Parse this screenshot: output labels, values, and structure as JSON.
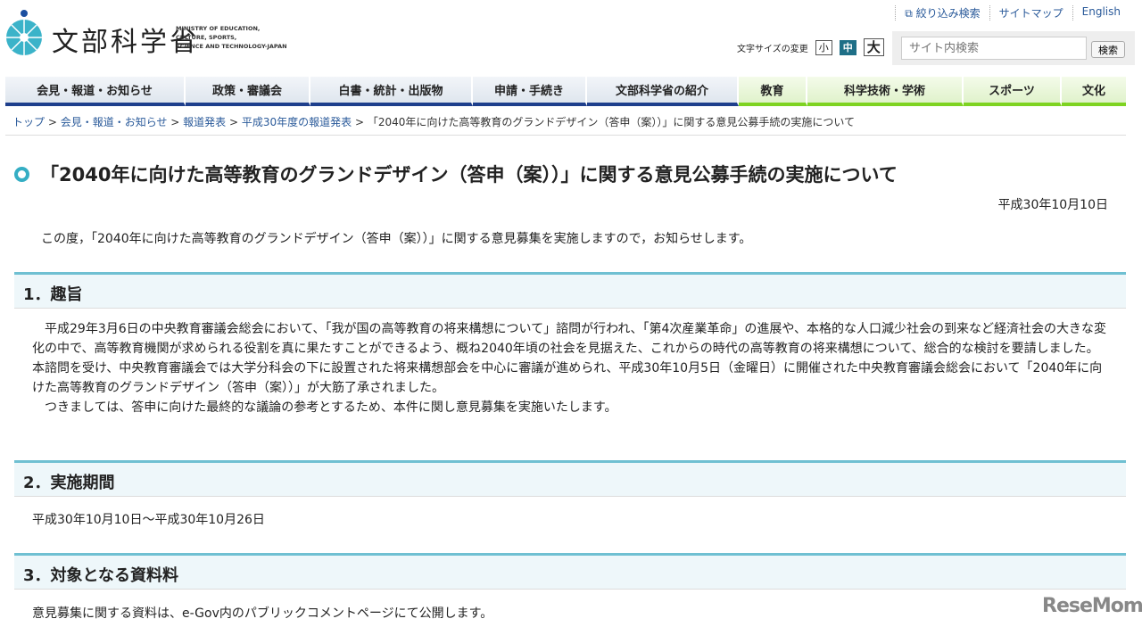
{
  "header": {
    "logo_jp": "文部科学省",
    "logo_en": [
      "MINISTRY OF EDUCATION,",
      "CULTURE, SPORTS,",
      "SCIENCE AND TECHNOLOGY-JAPAN"
    ],
    "links": [
      "絞り込み検索",
      "サイトマップ",
      "English"
    ],
    "font_size_label": "文字サイズの変更",
    "font_sizes": [
      "小",
      "中",
      "大"
    ],
    "search_placeholder": "サイト内検索",
    "search_button": "検索"
  },
  "nav": [
    "会見・報道・お知らせ",
    "政策・審議会",
    "白書・統計・出版物",
    "申請・手続き",
    "文部科学省の紹介",
    "教育",
    "科学技術・学術",
    "スポーツ",
    "文化"
  ],
  "breadcrumb": [
    "トップ",
    "会見・報道・お知らせ",
    "報道発表",
    "平成30年度の報道発表",
    "「2040年に向けた高等教育のグランドデザイン（答申（案））」に関する意見公募手続の実施について"
  ],
  "page": {
    "title": "「2040年に向けた高等教育のグランドデザイン（答申（案））」に関する意見公募手続の実施について",
    "date": "平成30年10月10日",
    "intro": "この度，「2040年に向けた高等教育のグランドデザイン（答申（案））」に関する意見募集を実施しますので，お知らせします。",
    "sections": [
      {
        "heading": "1．趣旨",
        "paragraphs": [
          "　平成29年3月6日の中央教育審議会総会において、「我が国の高等教育の将来構想について」諮問が行われ、「第4次産業革命」の進展や、本格的な人口減少社会の到来など経済社会の大きな変化の中で、高等教育機関が求められる役割を真に果たすことができるよう、概ね2040年頃の社会を見据えた、これからの時代の高等教育の将来構想について、総合的な検討を要請しました。",
          "本諮問を受け、中央教育審議会では大学分科会の下に設置された将来構想部会を中心に審議が進められ、平成30年10月5日（金曜日）に開催された中央教育審議会総会において「2040年に向けた高等教育のグランドデザイン（答申（案））」が大筋了承されました。",
          "　つきましては、答申に向けた最終的な議論の参考とするため、本件に関し意見募集を実施いたします。"
        ]
      },
      {
        "heading": "2．実施期間",
        "paragraphs": [
          "平成30年10月10日～平成30年10月26日"
        ]
      },
      {
        "heading": "3．対象となる資料料",
        "paragraphs": [
          "意見募集に関する資料は、e-Gov内のパブリックコメントページにて公開します。"
        ]
      }
    ]
  },
  "watermark": "ReseMom"
}
